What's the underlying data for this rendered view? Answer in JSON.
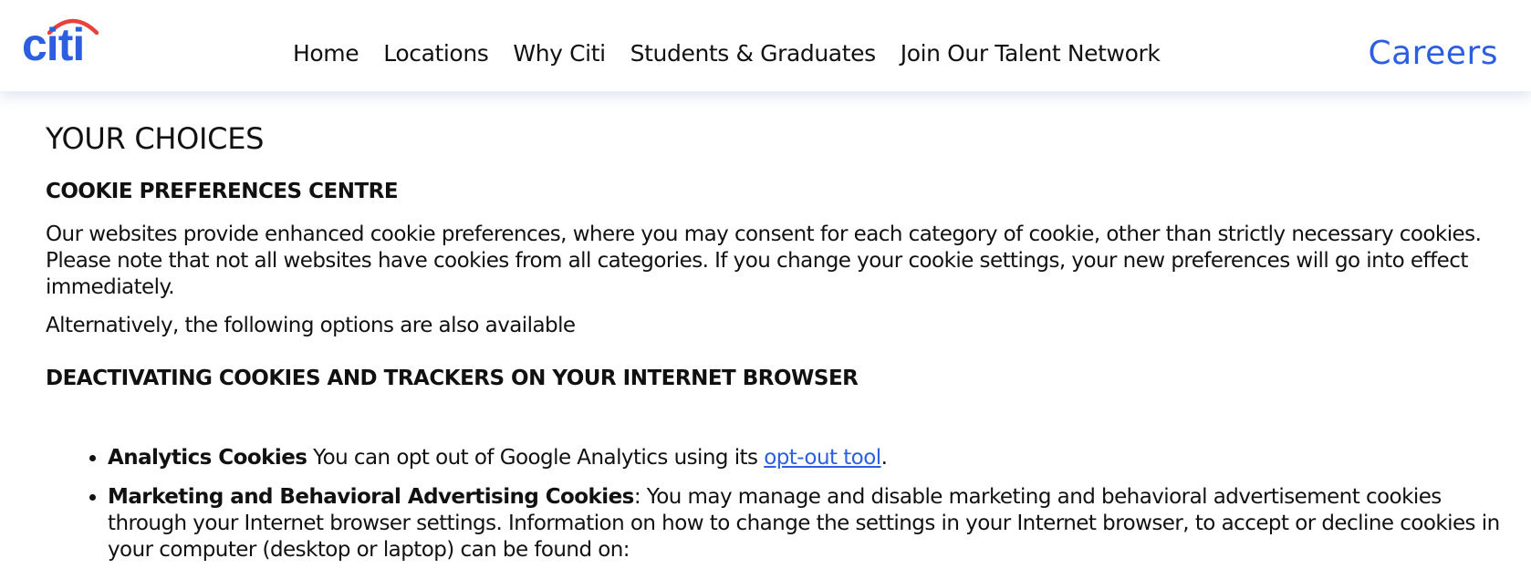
{
  "header": {
    "logo_text": "citi",
    "nav": [
      "Home",
      "Locations",
      "Why Citi",
      "Students & Graduates",
      "Join Our Talent Network"
    ],
    "careers_label": "Careers",
    "colors": {
      "brand_blue": "#2c5fe0",
      "arc_red": "#e8423c"
    }
  },
  "main": {
    "title": "YOUR CHOICES",
    "section1_heading": "COOKIE PREFERENCES CENTRE",
    "paragraph1": "Our websites provide enhanced cookie preferences, where you may consent for each category of cookie, other than strictly necessary cookies. Please note that not all websites have cookies from all categories. If you change your cookie settings, your new preferences will go into effect immediately.",
    "paragraph2": "Alternatively, the following options are also available",
    "section2_heading": "DEACTIVATING COOKIES AND TRACKERS ON YOUR INTERNET BROWSER",
    "bullets": [
      {
        "bold": "Analytics Cookies",
        "text_before_link": " You can opt out of Google Analytics using its ",
        "link": "opt-out tool",
        "text_after_link": "."
      },
      {
        "bold": "Marketing and Behavioral Advertising Cookies",
        "text": ": You may manage and disable marketing and behavioral advertisement cookies through your Internet browser settings. Information on how to change the settings in your Internet browser, to accept or decline cookies in your computer (desktop or laptop) can be found on:"
      }
    ]
  }
}
